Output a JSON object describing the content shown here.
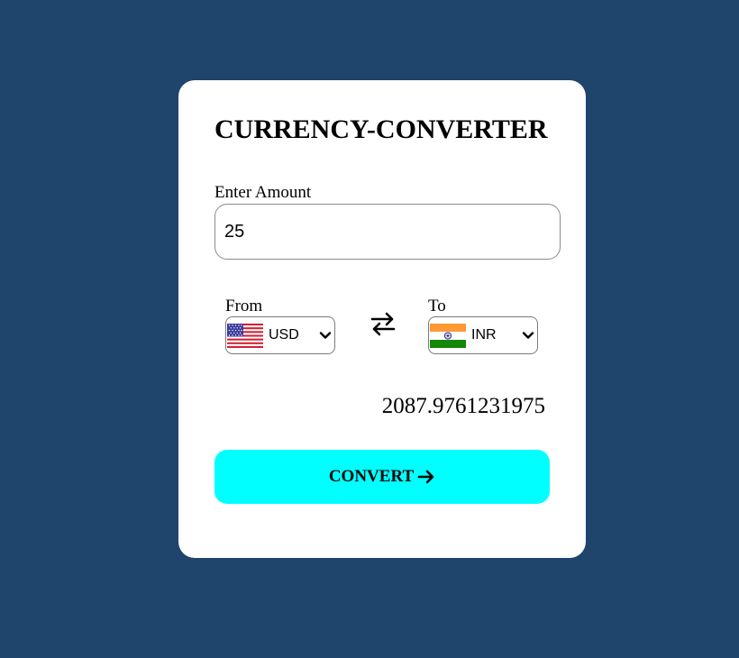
{
  "app": {
    "title": "CURRENCY-CONVERTER"
  },
  "amount": {
    "label": "Enter Amount",
    "value": "25"
  },
  "from": {
    "label": "From",
    "currency": "USD",
    "flag_icon": "us-flag-icon"
  },
  "to": {
    "label": "To",
    "currency": "INR",
    "flag_icon": "india-flag-icon"
  },
  "swap_icon": "swap-arrows-icon",
  "result": {
    "value": "2087.9761231975"
  },
  "convert_button": {
    "label": "CONVERT",
    "icon": "arrow-right-icon"
  },
  "colors": {
    "background": "#1f456d",
    "card": "#ffffff",
    "button": "#00ffff"
  }
}
